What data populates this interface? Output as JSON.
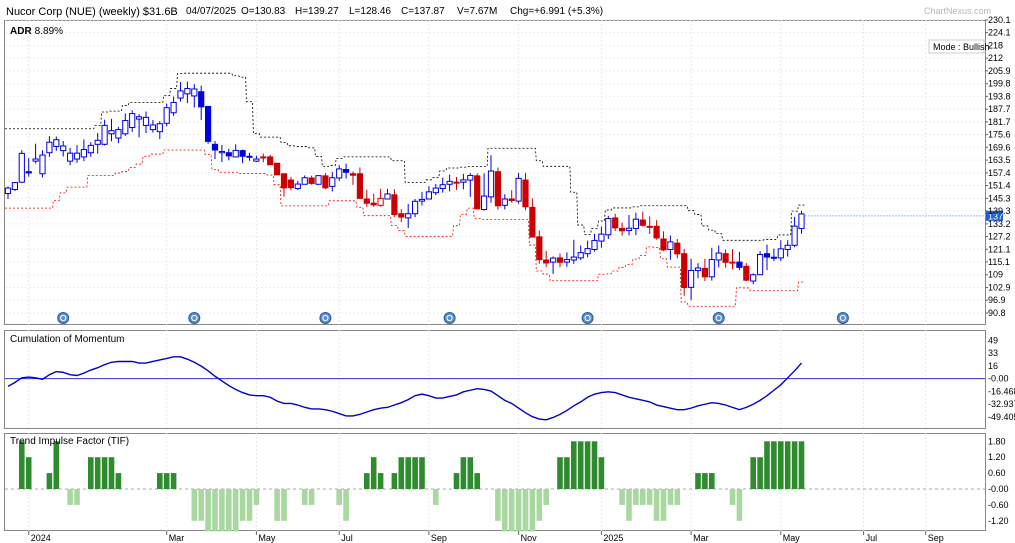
{
  "header": {
    "title": "Nucor Corp (NUE)  (weekly) $31.6B",
    "date": "04/07/2025",
    "open": "O=130.83",
    "high": "H=139.27",
    "low": "L=128.46",
    "close": "C=137.87",
    "volume": "V=7.67M",
    "change": "Chg=+6.991 (+5.3%)",
    "watermark": "ChartNexus.com"
  },
  "price_panel": {
    "adr_label": "ADR",
    "adr_value": "8.89%",
    "mode": "Mode : Bullish",
    "price_tag": "137",
    "yticks": [
      "230.1",
      "224.1",
      "218",
      "212",
      "205.9",
      "199.8",
      "193.8",
      "187.7",
      "181.7",
      "175.6",
      "169.6",
      "163.5",
      "157.4",
      "151.4",
      "145.3",
      "139.3",
      "133.2",
      "127.2",
      "121.1",
      "115.1",
      "109",
      "102.9",
      "96.9",
      "90.8"
    ],
    "ytick_values": [
      230.1,
      224.1,
      218,
      212,
      205.9,
      199.8,
      193.8,
      187.7,
      181.7,
      175.6,
      169.6,
      163.5,
      157.4,
      151.4,
      145.3,
      139.3,
      133.2,
      127.2,
      121.1,
      115.1,
      109,
      102.9,
      96.9,
      90.8
    ]
  },
  "momentum_panel": {
    "title": "Cumulation of Momentum",
    "yticks": [
      "49",
      "33",
      "16",
      "-0.00",
      "-16.468",
      "-32.937",
      "-49.405"
    ],
    "ytick_values": [
      49,
      33,
      16,
      0,
      -16.468,
      -32.937,
      -49.405
    ]
  },
  "tif_panel": {
    "title": "Trend Impulse Factor (TIF)",
    "yticks": [
      "1.80",
      "1.20",
      "0.60",
      "-0.00",
      "-0.60",
      "-1.20"
    ],
    "ytick_values": [
      1.8,
      1.2,
      0.6,
      0,
      -0.6,
      -1.2
    ]
  },
  "xaxis": {
    "labels": [
      "2024",
      "Mar",
      "May",
      "Jul",
      "Sep",
      "Nov",
      "2025",
      "Mar",
      "May",
      "Jul",
      "Sep"
    ],
    "week_index": [
      3,
      23,
      36,
      48,
      61,
      74,
      86,
      99,
      112,
      124,
      133
    ]
  },
  "colors": {
    "bull": "#0000e0",
    "bear": "#cc0000",
    "momentum": "#0000cc",
    "tif_pos": "#2e8b2e",
    "tif_neg": "#a8d8a0",
    "stop_upper": "#000000",
    "stop_lower": "#ff0000"
  },
  "chart_data": {
    "type": "candlestick",
    "title": "Nucor Corp (NUE)  (weekly) $31.6B",
    "xlabel": "",
    "ylabel": "",
    "ylim": [
      90.8,
      230.1
    ],
    "last_price": 137,
    "candles": [
      [
        147.6,
        151.0,
        145.0,
        150.2,
        "bull"
      ],
      [
        149.5,
        153.0,
        148.8,
        152.8,
        "bull"
      ],
      [
        153,
        168.2,
        152.5,
        166.7,
        "bull"
      ],
      [
        158,
        164.4,
        155.7,
        157.4,
        "bull"
      ],
      [
        163,
        171.3,
        161.8,
        164.0,
        "bull"
      ],
      [
        157,
        168.2,
        155.3,
        165.9,
        "bull"
      ],
      [
        167,
        174.9,
        165.0,
        172.0,
        "bull"
      ],
      [
        170,
        174.7,
        167.9,
        173.2,
        "bull"
      ],
      [
        168,
        172.6,
        165.2,
        170.2,
        "bull"
      ],
      [
        163,
        169.3,
        161.0,
        166.8,
        "bull"
      ],
      [
        164,
        170.6,
        162.2,
        166.8,
        "bull"
      ],
      [
        165,
        173.3,
        163.0,
        168.5,
        "bull"
      ],
      [
        167,
        172.0,
        165.0,
        170.5,
        "bull"
      ],
      [
        171,
        176.4,
        166.6,
        172.9,
        "bull"
      ],
      [
        171,
        182.7,
        170.4,
        180.0,
        "bull"
      ],
      [
        176,
        183.1,
        172.4,
        177.5,
        "bull"
      ],
      [
        174,
        179.3,
        171.5,
        178.0,
        "bull"
      ],
      [
        176,
        185.7,
        175.0,
        182.3,
        "bull"
      ],
      [
        179,
        187.2,
        176.9,
        185.6,
        "bull"
      ],
      [
        183,
        185.4,
        174.3,
        184.1,
        "bull"
      ],
      [
        180,
        186.6,
        176.3,
        183.8,
        "bull"
      ],
      [
        178,
        182.5,
        176.6,
        180.2,
        "bull"
      ],
      [
        177,
        182.0,
        173.5,
        180.8,
        "bull"
      ],
      [
        181,
        190.4,
        179.5,
        188.4,
        "bull"
      ],
      [
        186,
        193.7,
        184.5,
        190.9,
        "bull"
      ],
      [
        193,
        200.6,
        191.3,
        196.4,
        "bull"
      ],
      [
        195,
        200.8,
        190.6,
        197.5,
        "bull"
      ],
      [
        194,
        199.6,
        188.5,
        197.3,
        "bull"
      ],
      [
        196,
        198.9,
        182.6,
        188.8,
        "bull"
      ],
      [
        189,
        187.5,
        171.3,
        172.4,
        "bull"
      ],
      [
        171,
        172.6,
        164.0,
        168.3,
        "bull"
      ],
      [
        167,
        170.7,
        162.6,
        167.6,
        "bull"
      ],
      [
        167,
        168.9,
        163.4,
        165.5,
        "bull"
      ],
      [
        165,
        171.0,
        165.0,
        168.1,
        "bull"
      ],
      [
        168,
        168.5,
        162.0,
        165.3,
        "bull"
      ],
      [
        165,
        167.0,
        163.2,
        165.3,
        "bull"
      ],
      [
        163,
        165.6,
        162.6,
        164.0,
        "bull"
      ],
      [
        165,
        166.6,
        162.5,
        164.9,
        "bear"
      ],
      [
        165,
        166.0,
        161.2,
        161.3,
        "bear"
      ],
      [
        162,
        162.0,
        156.5,
        156.5,
        "bear"
      ],
      [
        157,
        156.8,
        146.1,
        150.3,
        "bear"
      ],
      [
        154,
        155.5,
        149.2,
        150.4,
        "bear"
      ],
      [
        150,
        153.6,
        149.3,
        152.1,
        "bull"
      ],
      [
        152,
        156.2,
        152.4,
        155.1,
        "bull"
      ],
      [
        155,
        156.1,
        151.8,
        152.4,
        "bear"
      ],
      [
        152,
        156.4,
        151.8,
        156.1,
        "bull"
      ],
      [
        156,
        157.3,
        149.6,
        150.3,
        "bear"
      ],
      [
        151,
        157.8,
        148.6,
        155.1,
        "bull"
      ],
      [
        155,
        161.1,
        153.6,
        159.3,
        "bull"
      ],
      [
        159,
        161.8,
        154.8,
        157.7,
        "bull"
      ],
      [
        157,
        158.1,
        151.7,
        156.3,
        "bear"
      ],
      [
        157,
        160.0,
        145.4,
        145.3,
        "bear"
      ],
      [
        145,
        149.4,
        141.3,
        143.0,
        "bear"
      ],
      [
        143,
        147.5,
        141.3,
        142.2,
        "bear"
      ],
      [
        142,
        149.9,
        141.3,
        145.3,
        "bear"
      ],
      [
        145,
        149.8,
        144.8,
        147.4,
        "bull"
      ],
      [
        147,
        149.6,
        136.5,
        137.6,
        "bear"
      ],
      [
        138,
        140.2,
        134.0,
        136.4,
        "bear"
      ],
      [
        136,
        142.6,
        131.2,
        138.0,
        "bull"
      ],
      [
        138,
        145.0,
        136.4,
        143.9,
        "bull"
      ],
      [
        144,
        148.4,
        141.9,
        144.8,
        "bull"
      ],
      [
        145,
        151.1,
        145.0,
        148.4,
        "bull"
      ],
      [
        148,
        152.1,
        146.8,
        150.2,
        "bull"
      ],
      [
        150,
        155.2,
        148.0,
        151.8,
        "bull"
      ],
      [
        152,
        156.6,
        148.6,
        153.4,
        "bull"
      ],
      [
        153,
        155.5,
        149.3,
        153.0,
        "bear"
      ],
      [
        153,
        157.0,
        149.6,
        154.1,
        "bull"
      ],
      [
        154,
        157.3,
        146.0,
        156.2,
        "bull"
      ],
      [
        156,
        157.2,
        140.0,
        140.3,
        "bear"
      ],
      [
        140,
        157.2,
        139.5,
        146.4,
        "bull"
      ],
      [
        146,
        165.8,
        143.2,
        158.3,
        "bull"
      ],
      [
        158,
        160.0,
        140.0,
        141.8,
        "bear"
      ],
      [
        142,
        147.3,
        140.0,
        145.0,
        "bull"
      ],
      [
        145,
        149.2,
        143.3,
        144.3,
        "bear"
      ],
      [
        144,
        157.4,
        142.8,
        154.8,
        "bull"
      ],
      [
        154,
        157.4,
        139.7,
        141.3,
        "bear"
      ],
      [
        141,
        145.3,
        126.9,
        126.9,
        "bear"
      ],
      [
        127,
        130.0,
        114.2,
        116.2,
        "bear"
      ],
      [
        116,
        120.3,
        112.7,
        114.6,
        "bear"
      ],
      [
        115,
        117.7,
        109.4,
        116.9,
        "bull"
      ],
      [
        117,
        119.1,
        112.6,
        114.9,
        "bear"
      ],
      [
        115,
        119.6,
        112.8,
        116.2,
        "bull"
      ],
      [
        116,
        125.6,
        114.2,
        117.4,
        "bull"
      ],
      [
        117,
        122.9,
        116.0,
        119.5,
        "bull"
      ],
      [
        119,
        125.2,
        117.3,
        121.4,
        "bull"
      ],
      [
        121,
        128.4,
        120.0,
        125.3,
        "bull"
      ],
      [
        125,
        131.9,
        121.8,
        128.3,
        "bull"
      ],
      [
        128,
        137.0,
        126.0,
        135.7,
        "bull"
      ],
      [
        136,
        138.0,
        129.8,
        131.3,
        "bear"
      ],
      [
        131,
        133.8,
        127.6,
        129.9,
        "bear"
      ],
      [
        130,
        137.4,
        127.7,
        131.1,
        "bull"
      ],
      [
        131,
        138.5,
        127.8,
        135.4,
        "bull"
      ],
      [
        135,
        139.0,
        131.8,
        132.5,
        "bear"
      ],
      [
        132,
        136.7,
        128.4,
        131.6,
        "bear"
      ],
      [
        132,
        134.9,
        125.7,
        126.5,
        "bear"
      ],
      [
        126,
        129.6,
        120.2,
        120.8,
        "bear"
      ],
      [
        121,
        127.6,
        116.1,
        124.6,
        "bull"
      ],
      [
        124,
        126.0,
        116.8,
        118.9,
        "bear"
      ],
      [
        119,
        121.3,
        99.0,
        102.9,
        "bear"
      ],
      [
        103,
        116.6,
        96.9,
        111.0,
        "bull"
      ],
      [
        111,
        114.5,
        107.3,
        112.2,
        "bull"
      ],
      [
        112,
        116.6,
        106.0,
        108.0,
        "bear"
      ],
      [
        108,
        121.8,
        106.2,
        116.2,
        "bull"
      ],
      [
        116,
        122.9,
        112.5,
        119.3,
        "bull"
      ],
      [
        119,
        121.0,
        112.4,
        114.9,
        "bear"
      ],
      [
        115,
        121.1,
        111.6,
        115.0,
        "bear"
      ],
      [
        115,
        119.9,
        111.2,
        112.5,
        "bull"
      ],
      [
        113,
        114.5,
        105.9,
        106.4,
        "bear"
      ],
      [
        106,
        109.6,
        104.5,
        109.0,
        "bull"
      ],
      [
        109,
        120.2,
        108.8,
        118.6,
        "bull"
      ],
      [
        119,
        123.3,
        111.2,
        117.4,
        "bull"
      ],
      [
        117,
        121.4,
        115.5,
        117.3,
        "bull"
      ],
      [
        117,
        125.4,
        115.6,
        121.3,
        "bull"
      ],
      [
        121,
        125.4,
        117.6,
        123.0,
        "bull"
      ],
      [
        123,
        136.5,
        122.1,
        132.1,
        "bull"
      ],
      [
        131,
        139.3,
        128.5,
        137.9,
        "bull"
      ]
    ],
    "upper_stop": [
      null,
      null,
      null,
      null,
      null,
      null,
      null,
      null,
      null,
      null,
      null,
      null,
      null,
      null,
      null,
      null,
      null,
      null,
      null,
      null,
      null,
      null,
      null,
      null,
      null,
      null,
      null,
      null,
      null,
      null,
      null,
      null,
      null,
      null,
      null,
      null,
      null,
      null,
      null,
      null,
      null,
      null,
      null,
      null,
      null,
      null,
      null,
      null,
      null,
      null,
      null,
      null,
      null,
      null,
      null,
      null,
      null,
      null,
      null,
      null,
      null,
      null,
      null,
      null,
      null,
      null,
      null,
      null,
      null,
      null,
      null,
      null,
      null,
      null,
      null,
      null,
      null,
      null,
      null,
      null,
      null,
      null,
      null,
      null,
      null,
      null,
      null,
      null,
      null,
      null,
      null,
      null,
      null,
      null,
      null,
      null,
      null,
      null,
      null,
      null,
      null,
      null,
      null,
      null,
      null,
      null,
      null,
      null,
      null,
      null,
      null,
      null,
      null,
      null,
      null,
      null,
      null,
      null,
      null,
      null
    ],
    "momentum": [
      -10,
      -5,
      1,
      2,
      1,
      -1,
      5,
      9,
      8,
      5,
      4,
      7,
      11,
      14,
      18,
      21,
      22,
      22,
      22,
      20,
      20,
      22,
      24,
      26,
      28,
      28,
      25,
      21,
      16,
      10,
      3,
      -3,
      -9,
      -14,
      -18,
      -21,
      -22,
      -22,
      -24,
      -29,
      -32,
      -32,
      -34,
      -37,
      -39,
      -39,
      -40,
      -42,
      -45,
      -48,
      -48,
      -46,
      -43,
      -40,
      -38,
      -37,
      -34,
      -31,
      -27,
      -22,
      -20,
      -22,
      -25,
      -25,
      -23,
      -21,
      -17,
      -15,
      -13,
      -14,
      -16,
      -22,
      -28,
      -32,
      -38,
      -44,
      -49,
      -52,
      -53,
      -50,
      -46,
      -41,
      -35,
      -30,
      -24,
      -20,
      -18,
      -17,
      -18,
      -21,
      -24,
      -26,
      -28,
      -30,
      -34,
      -36,
      -38,
      -40,
      -40,
      -38,
      -35,
      -33,
      -31,
      -32,
      -34,
      -37,
      -40,
      -37,
      -33,
      -28,
      -22,
      -15,
      -8,
      1,
      10,
      20
    ]
  }
}
